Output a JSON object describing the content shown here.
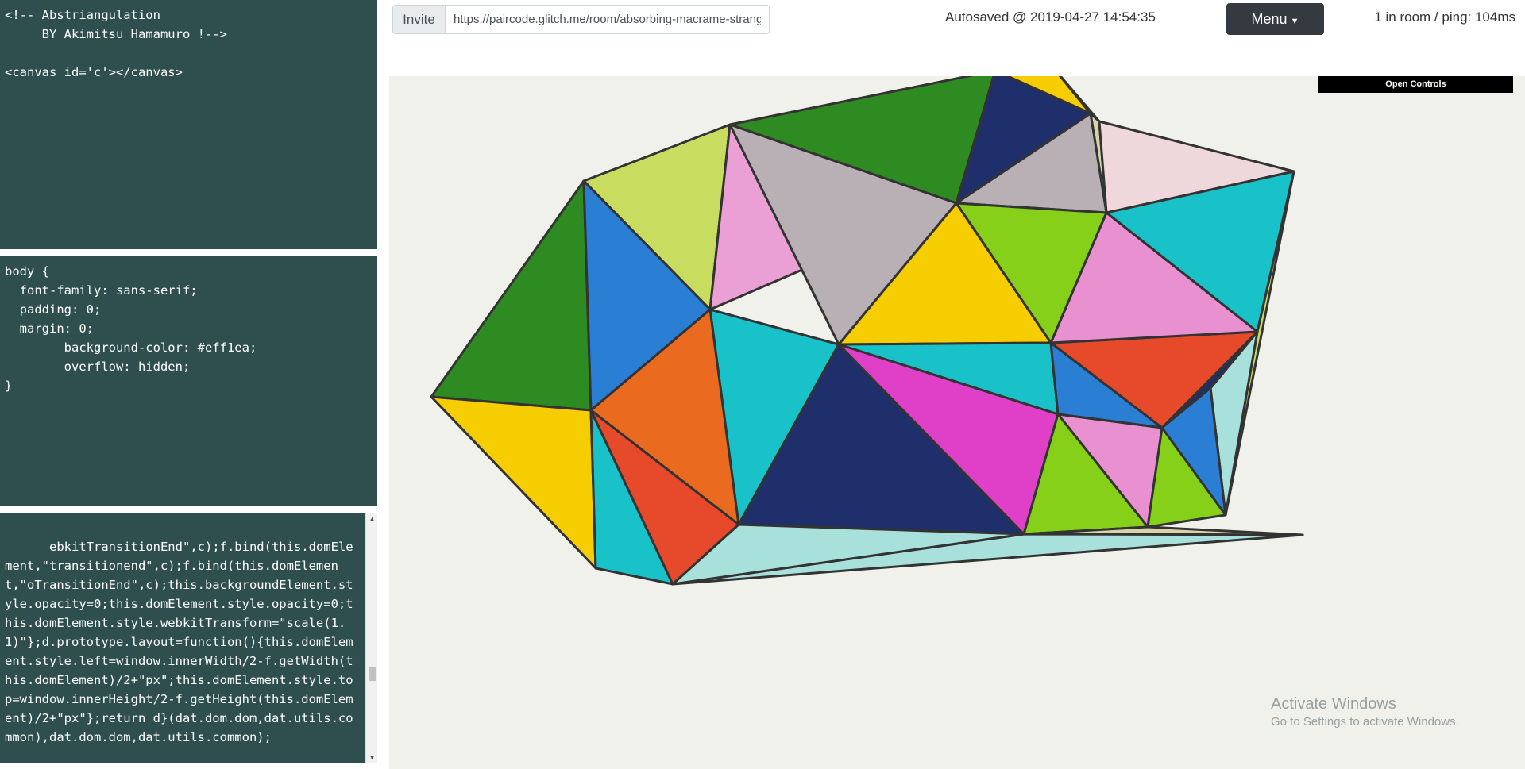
{
  "editor": {
    "html_code": "<!-- Abstriangulation\n     BY Akimitsu Hamamuro !-->\n\n<canvas id='c'></canvas>",
    "css_code": "body {\n  font-family: sans-serif;\n  padding: 0;\n  margin: 0;\n        background-color: #eff1ea;\n        overflow: hidden;\n}",
    "js_code": "ebkitTransitionEnd\",c);f.bind(this.domElement,\"transitionend\",c);f.bind(this.domElement,\"oTransitionEnd\",c);this.backgroundElement.style.opacity=0;this.domElement.style.opacity=0;this.domElement.style.webkitTransform=\"scale(1.1)\"};d.prototype.layout=function(){this.domElement.style.left=window.innerWidth/2-f.getWidth(this.domElement)/2+\"px\";this.domElement.style.top=window.innerHeight/2-f.getHeight(this.domElement)/2+\"px\"};return d}(dat.dom.dom,dat.utils.common),dat.dom.dom,dat.utils.common);"
  },
  "topbar": {
    "invite_label": "Invite",
    "invite_url": "https://paircode.glitch.me/room/absorbing-macrame-strang",
    "autosave_text": "Autosaved @ 2019-04-27 14:54:35",
    "menu_label": "Menu",
    "room_status": "1 in room / ping: 104ms"
  },
  "canvas": {
    "background": "#eff1ea",
    "stroke": "#333333",
    "open_controls_label": "Open Controls",
    "watermark_title": "Activate Windows",
    "watermark_sub": "Go to Settings to activate Windows.",
    "palette": {
      "green": "#2e8b22",
      "lime": "#c8dd5f",
      "blue": "#2a7fd4",
      "navy": "#1f2f6b",
      "yellow": "#f5cd00",
      "pink": "#eaa0d4",
      "orange": "#ea6a1f",
      "teal": "#19c2c8",
      "red": "#e64a2a",
      "magenta": "#e040c8",
      "lightblue": "#a8e0dc",
      "grey": "#b8b0b4",
      "lightpink": "#eed8dc",
      "pinkish": "#e890d0",
      "limegreen": "#86d01a",
      "beige": "#d8d4a8"
    }
  }
}
